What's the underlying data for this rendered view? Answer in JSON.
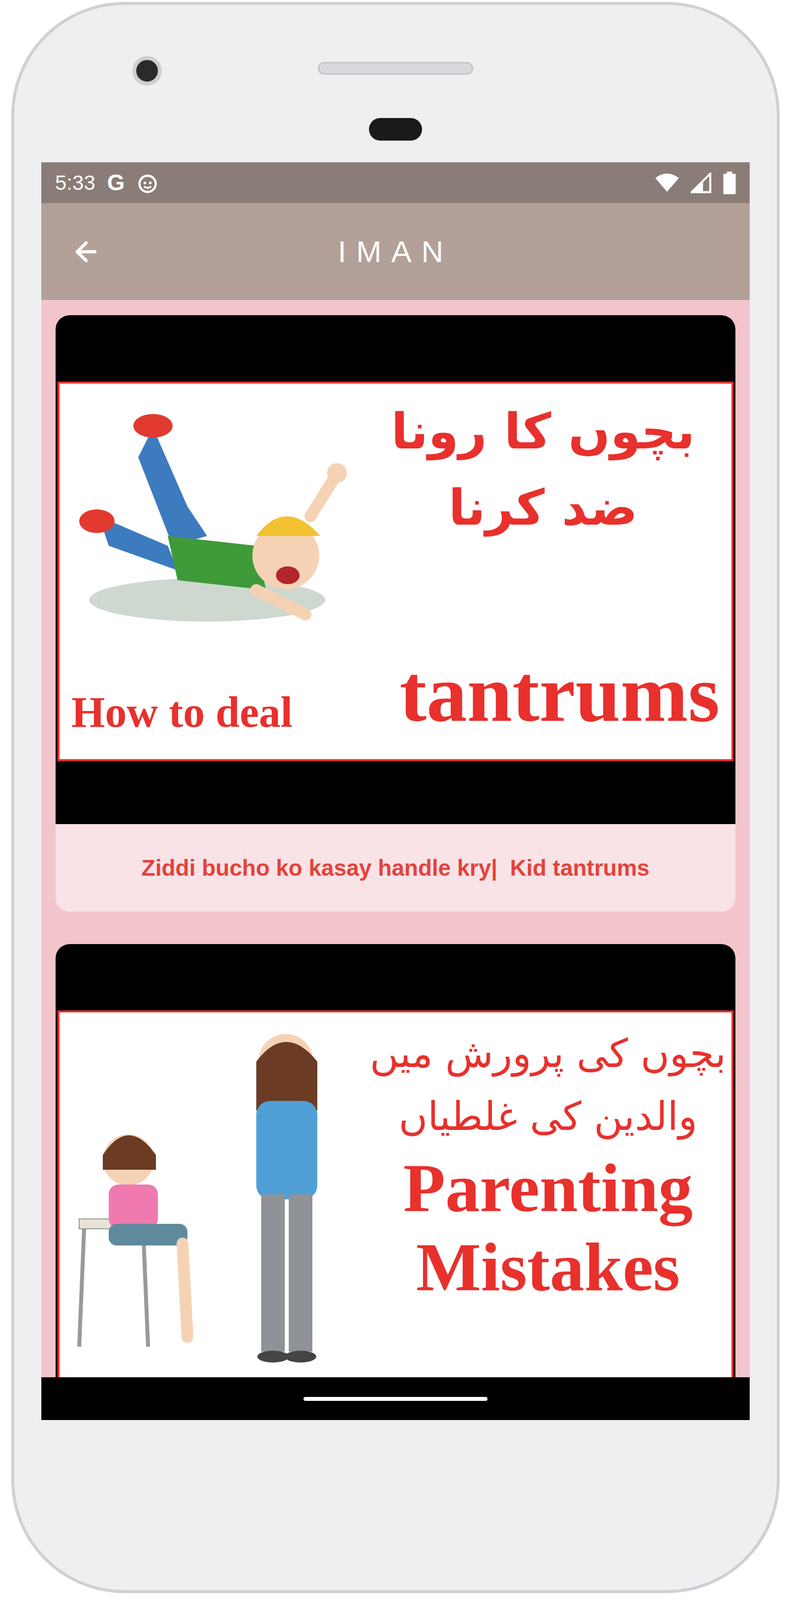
{
  "status_bar": {
    "time": "5:33",
    "notification": "G"
  },
  "toolbar": {
    "title": "IMAN"
  },
  "videos": [
    {
      "kind": "tantrum",
      "thumbnail": {
        "headline_urdu": [
          "بچوں کا رونا",
          "ضد کرنا"
        ],
        "subtitle": "How to deal",
        "headline": "tantrums"
      },
      "caption": "Ziddi bucho ko kasay handle kry|  Kid tantrums"
    },
    {
      "kind": "parenting",
      "thumbnail": {
        "headline_urdu": [
          "بچوں کی پرورش میں",
          "والدین کی غلطیاں"
        ],
        "headline_lines": [
          "Parenting",
          "Mistakes"
        ]
      }
    }
  ]
}
